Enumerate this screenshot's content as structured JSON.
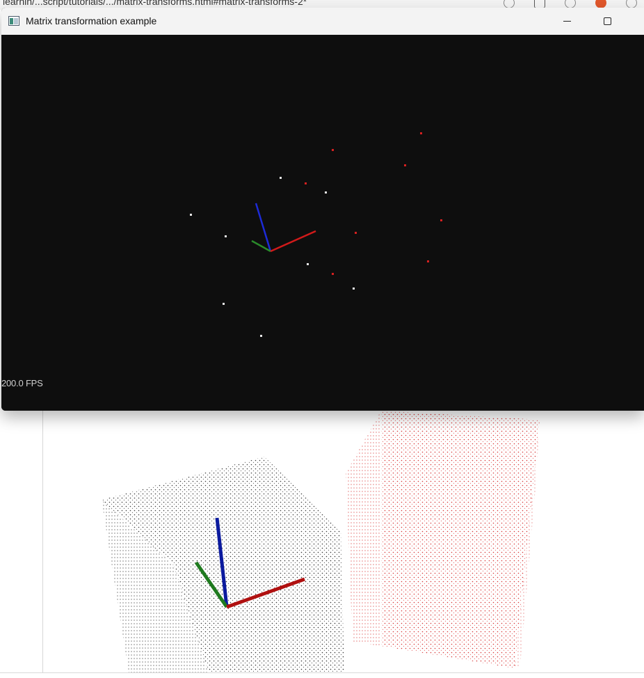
{
  "window": {
    "title": "Matrix transformation example",
    "fps_label": "200.0 FPS",
    "background_color": "#0e0e0e",
    "axis_colors": {
      "x": "#d11a1a",
      "y": "#2a8a2a",
      "z": "#1d2bd6"
    },
    "point_colors": {
      "original": "#e6e6e6",
      "transformed": "#d42020"
    }
  },
  "browser_bg": {
    "url_fragment": "learnin/...script/tutorials/.../matrix-transforms.html#matrix-transforms-2*"
  },
  "icons": {
    "app": "app-window-icon",
    "minimize": "minimize-icon",
    "maximize": "maximize-icon"
  }
}
